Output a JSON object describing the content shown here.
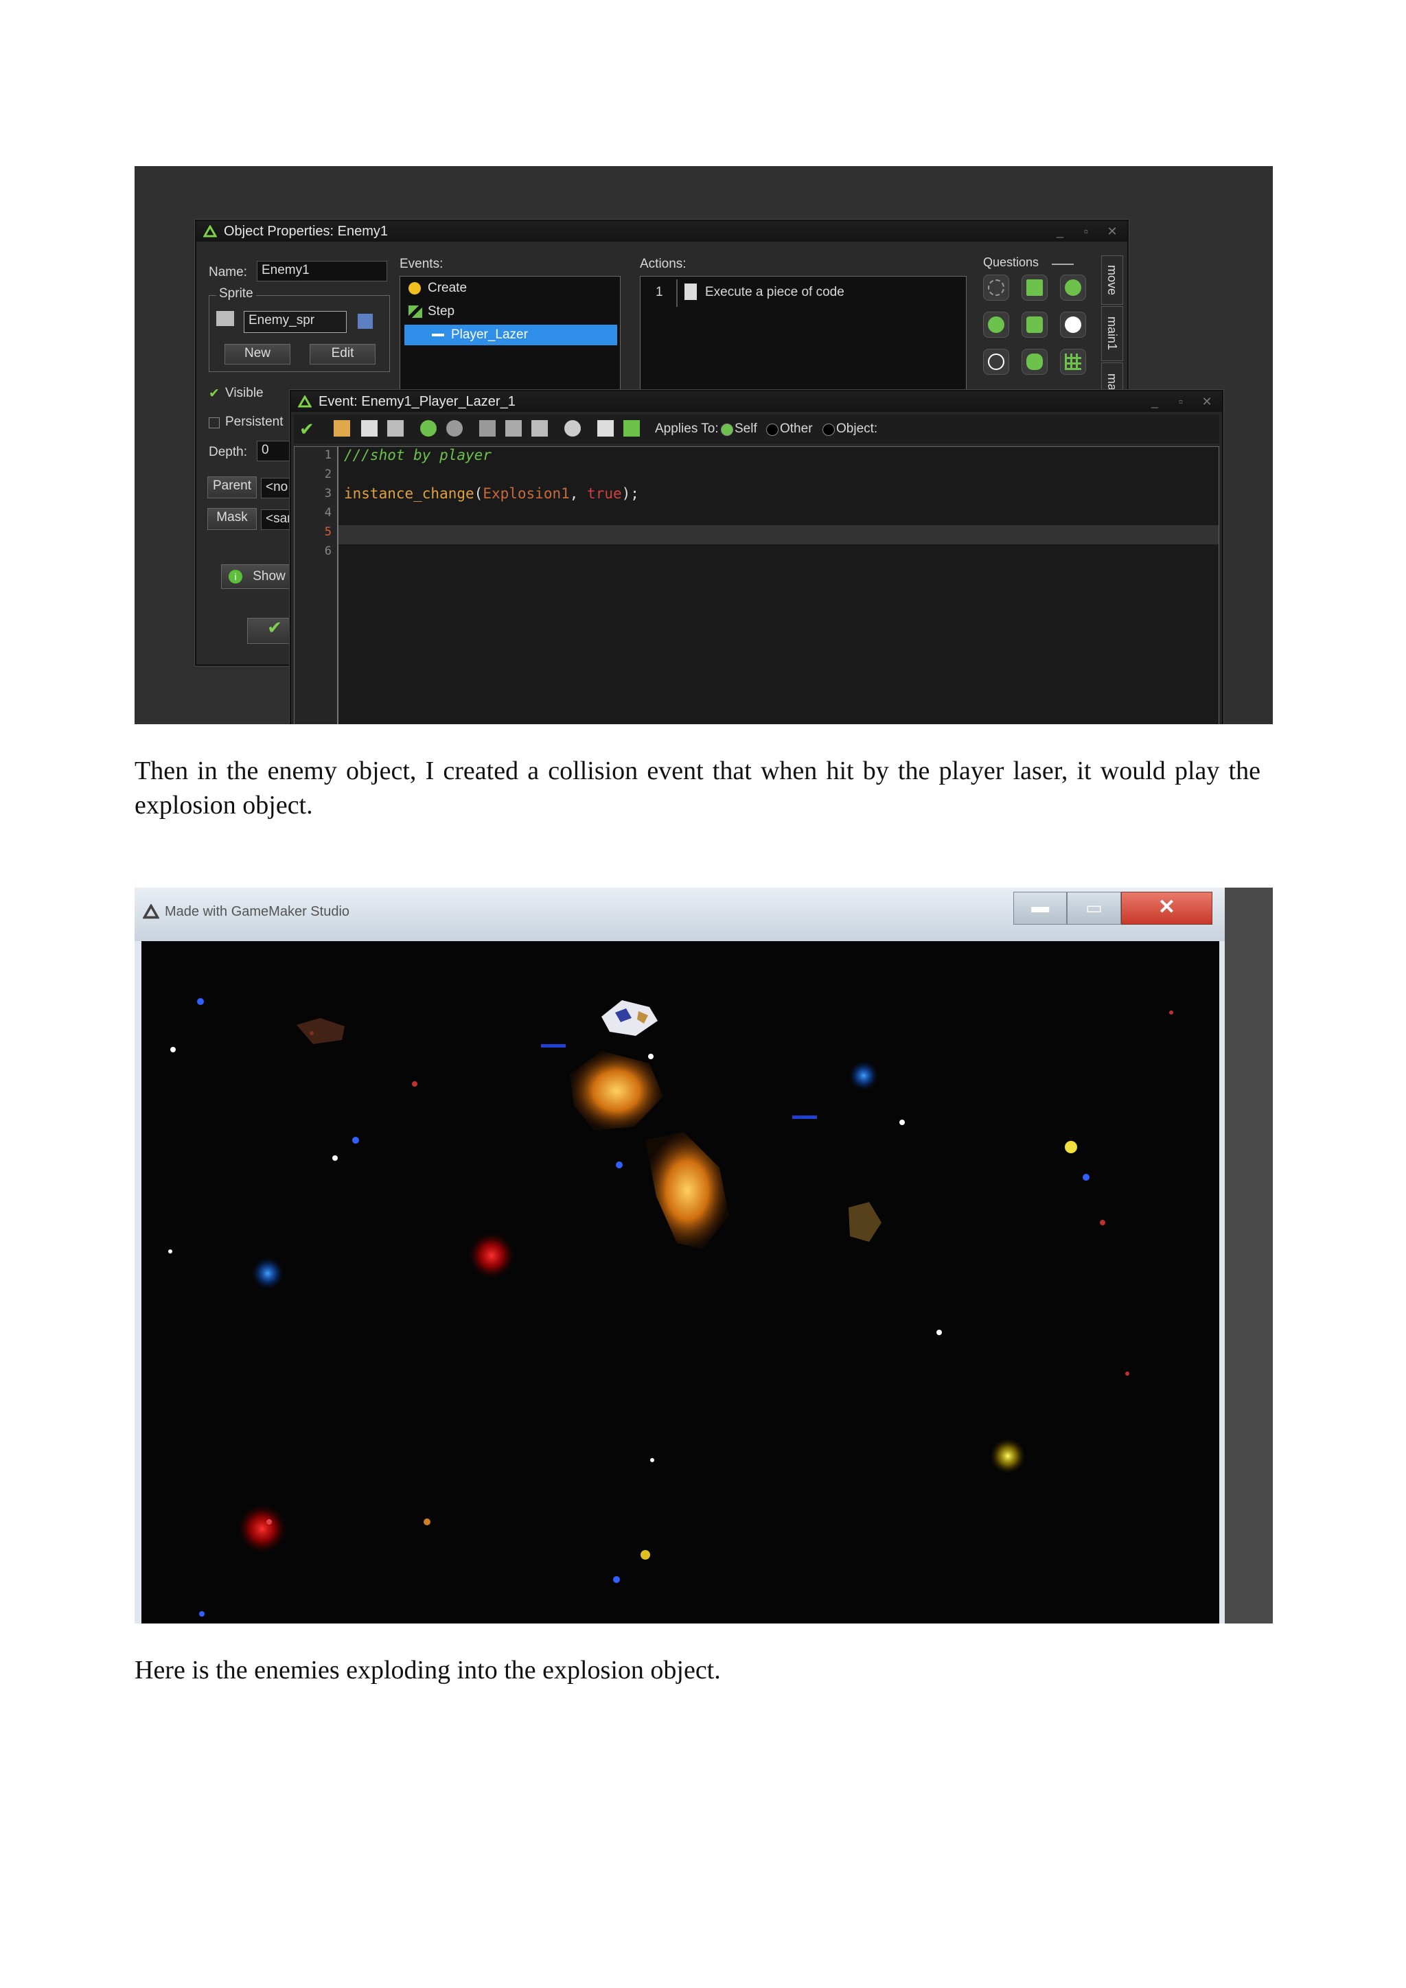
{
  "shot1": {
    "object_props": {
      "title": "Object Properties: Enemy1",
      "name_label": "Name:",
      "name_value": "Enemy1",
      "sprite_group": "Sprite",
      "sprite_value": "Enemy_spr",
      "new_button": "New",
      "edit_button": "Edit",
      "visible_label": "Visible",
      "persistent_label": "Persistent",
      "depth_label": "Depth:",
      "depth_value": "0",
      "parent_button": "Parent",
      "parent_value": "<no",
      "mask_button": "Mask",
      "mask_value": "<sar",
      "show_button": "Show",
      "events_label": "Events:",
      "events": [
        {
          "label": "Create",
          "icon": "bulb-icon"
        },
        {
          "label": "Step",
          "icon": "step-icon"
        },
        {
          "label": "Player_Lazer",
          "icon": "collision-icon",
          "selected": true
        }
      ],
      "actions_label": "Actions:",
      "action_index": "1",
      "action_text": "Execute a piece of code",
      "questions_label": "Questions",
      "tabs": [
        "move",
        "main1",
        "main"
      ]
    },
    "event_window": {
      "title": "Event: Enemy1_Player_Lazer_1",
      "applies_to_label": "Applies To:",
      "applies_options": [
        "Self",
        "Other",
        "Object:"
      ],
      "applies_selected": "Self",
      "line_numbers": [
        "1",
        "2",
        "3",
        "4",
        "5",
        "6"
      ],
      "code_line1": "///shot by player",
      "code_fn": "instance_change",
      "code_paren_open": "(",
      "code_arg": "Explosion1",
      "code_comma": ", ",
      "code_true": "true",
      "code_end": ");"
    }
  },
  "caption1": "Then in the enemy object, I created a collision event that when hit by the player laser, it would play the explosion object.",
  "shot2": {
    "window_title": "Made with GameMaker Studio"
  },
  "caption2": "Here is the enemies exploding into the explosion object.",
  "colors": {
    "selection_blue": "#2f8ee8",
    "code_comment": "#6cc24a",
    "code_function": "#e0a040",
    "code_keyword": "#d04040",
    "close_red": "#d9483b"
  }
}
